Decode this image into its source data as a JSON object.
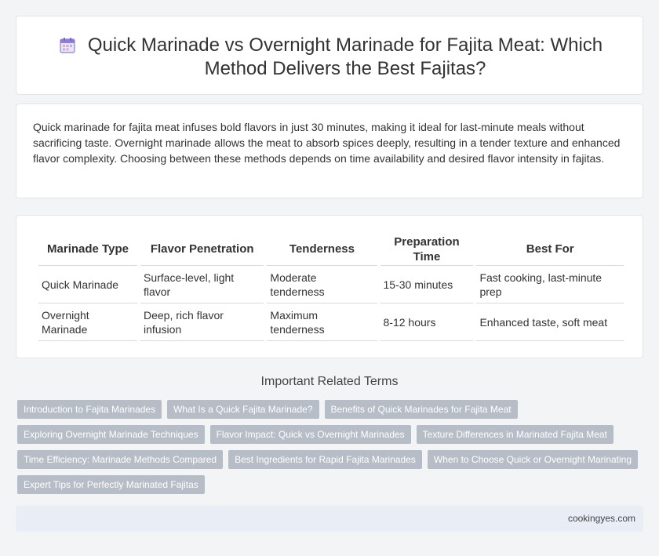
{
  "header": {
    "title": "Quick Marinade vs Overnight Marinade for Fajita Meat: Which Method Delivers the Best Fajitas?",
    "icon": "calendar-icon"
  },
  "intro": {
    "text": "Quick marinade for fajita meat infuses bold flavors in just 30 minutes, making it ideal for last-minute meals without sacrificing taste. Overnight marinade allows the meat to absorb spices deeply, resulting in a tender texture and enhanced flavor complexity. Choosing between these methods depends on time availability and desired flavor intensity in fajitas."
  },
  "table": {
    "headers": [
      "Marinade Type",
      "Flavor Penetration",
      "Tenderness",
      "Preparation Time",
      "Best For"
    ],
    "rows": [
      [
        "Quick Marinade",
        "Surface-level, light flavor",
        "Moderate tenderness",
        "15-30 minutes",
        "Fast cooking, last-minute prep"
      ],
      [
        "Overnight Marinade",
        "Deep, rich flavor infusion",
        "Maximum tenderness",
        "8-12 hours",
        "Enhanced taste, soft meat"
      ]
    ]
  },
  "related": {
    "title": "Important Related Terms",
    "tags": [
      "Introduction to Fajita Marinades",
      "What Is a Quick Fajita Marinade?",
      "Benefits of Quick Marinades for Fajita Meat",
      "Exploring Overnight Marinade Techniques",
      "Flavor Impact: Quick vs Overnight Marinades",
      "Texture Differences in Marinated Fajita Meat",
      "Time Efficiency: Marinade Methods Compared",
      "Best Ingredients for Rapid Fajita Marinades",
      "When to Choose Quick or Overnight Marinating",
      "Expert Tips for Perfectly Marinated Fajitas"
    ]
  },
  "footer": {
    "site": "cookingyes.com"
  }
}
